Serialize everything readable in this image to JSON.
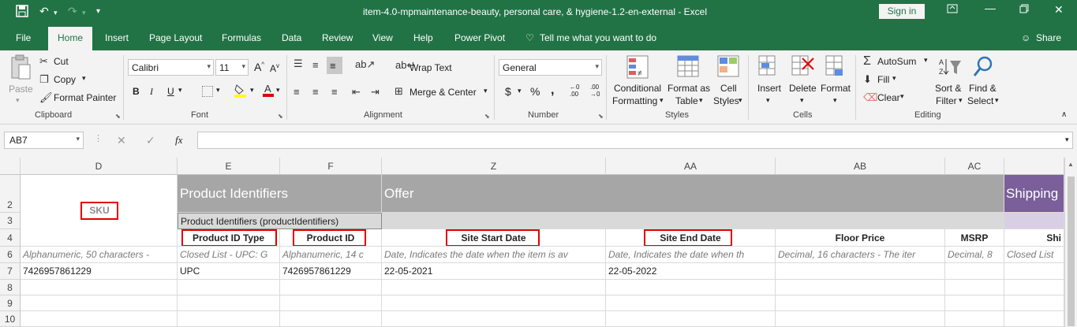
{
  "titlebar": {
    "title": "item-4.0-mpmaintenance-beauty, personal care, & hygiene-1.2-en-external  -  Excel",
    "signin": "Sign in"
  },
  "tabs": [
    "File",
    "Home",
    "Insert",
    "Page Layout",
    "Formulas",
    "Data",
    "Review",
    "View",
    "Help",
    "Power Pivot",
    "Tell me what you want to do",
    "Share"
  ],
  "ribbon": {
    "clipboard": {
      "paste": "Paste",
      "cut": "Cut",
      "copy": "Copy",
      "format_painter": "Format Painter",
      "group": "Clipboard"
    },
    "font": {
      "name": "Calibri",
      "size": "11",
      "group": "Font"
    },
    "alignment": {
      "wrap": "Wrap Text",
      "merge": "Merge & Center",
      "group": "Alignment"
    },
    "number": {
      "format": "General",
      "group": "Number"
    },
    "styles": {
      "conditional": "Conditional",
      "formatting": "Formatting",
      "format_as": "Format as",
      "table": "Table",
      "cell": "Cell",
      "styles": "Styles",
      "group": "Styles"
    },
    "cells": {
      "insert": "Insert",
      "delete": "Delete",
      "format": "Format",
      "group": "Cells"
    },
    "editing": {
      "autosum": "AutoSum",
      "fill": "Fill",
      "clear": "Clear",
      "sort": "Sort &",
      "filter": "Filter",
      "find": "Find &",
      "select": "Select",
      "group": "Editing"
    }
  },
  "formula_bar": {
    "name_box": "AB7",
    "fx": "fx",
    "value": ""
  },
  "columns": [
    "D",
    "E",
    "F",
    "Z",
    "AA",
    "AB",
    "AC"
  ],
  "rows": [
    "2",
    "3",
    "4",
    "6",
    "7",
    "8",
    "9",
    "10"
  ],
  "sheet": {
    "sku": "SKU",
    "product_identifiers": "Product Identifiers",
    "offer": "Offer",
    "shipping": "Shipping",
    "product_identifiers_sub": "Product Identifiers (productIdentifiers)",
    "headers": {
      "product_id_type": "Product ID Type",
      "product_id": "Product ID",
      "site_start_date": "Site Start Date",
      "site_end_date": "Site End Date",
      "floor_price": "Floor Price",
      "msrp": "MSRP",
      "shi": "Shi"
    },
    "descriptions": {
      "d": "Alphanumeric, 50 characters - ",
      "e": "Closed List - UPC: G",
      "f": "Alphanumeric, 14 c",
      "z": "Date, Indicates the date when the item is av",
      "aa": "Date, Indicates the date when th",
      "ab": "Decimal, 16 characters - The iter",
      "ac": "Decimal, 8",
      "shi": "Closed List"
    },
    "row7": {
      "d": "7426957861229",
      "e": "UPC",
      "f": "7426957861229",
      "z": "22-05-2021",
      "aa": "22-05-2022"
    }
  },
  "colors": {
    "excel_green": "#217346",
    "group_gray": "#a6a6a6",
    "sub_gray": "#d9d9d9",
    "shipping_purple": "#7a5f9a",
    "highlight_red": "#e00000"
  }
}
